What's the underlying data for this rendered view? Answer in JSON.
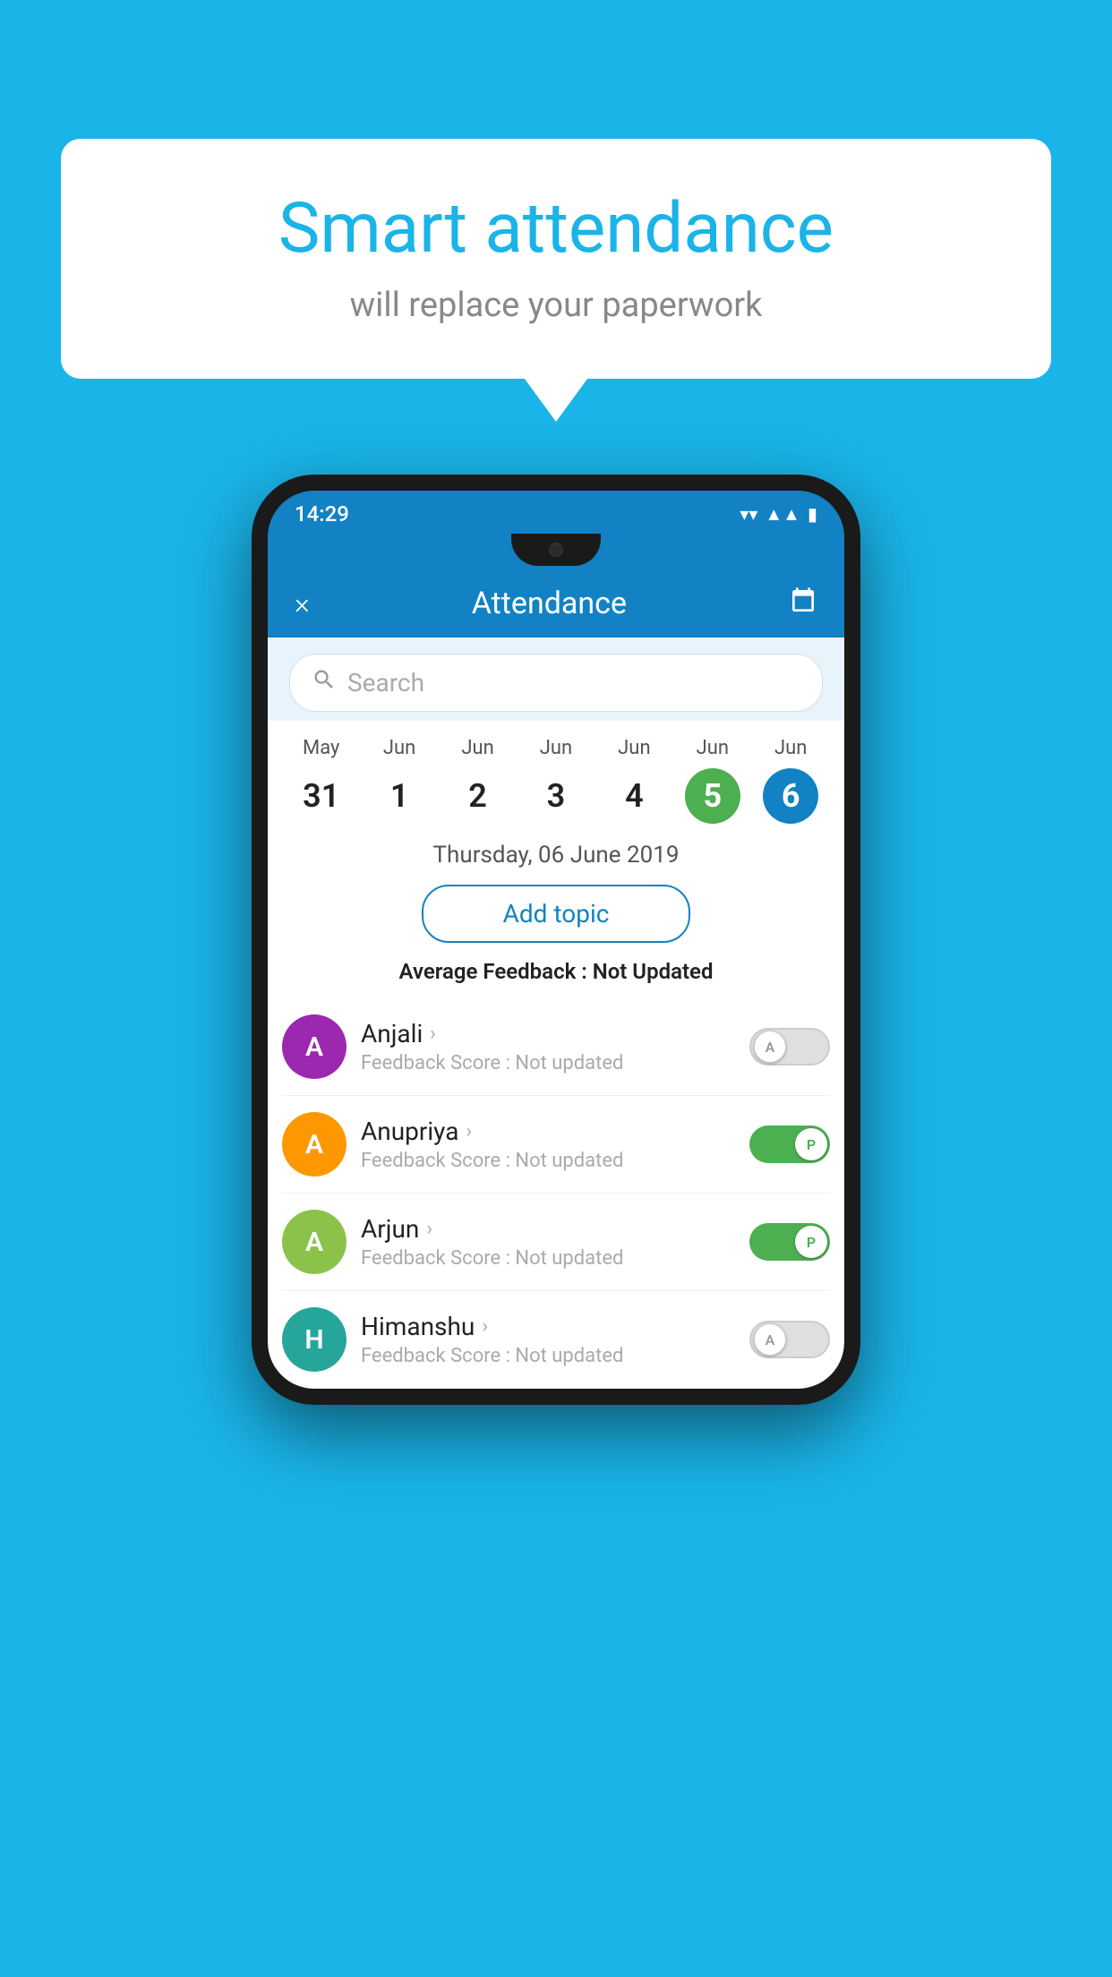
{
  "background_color": "#1ab4e8",
  "bubble": {
    "title": "Smart attendance",
    "subtitle": "will replace your paperwork"
  },
  "phone": {
    "status_bar": {
      "time": "14:29",
      "icons": [
        "wifi",
        "signal",
        "battery"
      ]
    },
    "header": {
      "close_label": "×",
      "title": "Attendance",
      "calendar_icon": "📅"
    },
    "search": {
      "placeholder": "Search"
    },
    "calendar": {
      "days": [
        {
          "month": "May",
          "date": "31",
          "active": false,
          "style": "none"
        },
        {
          "month": "Jun",
          "date": "1",
          "active": false,
          "style": "none"
        },
        {
          "month": "Jun",
          "date": "2",
          "active": false,
          "style": "none"
        },
        {
          "month": "Jun",
          "date": "3",
          "active": false,
          "style": "none"
        },
        {
          "month": "Jun",
          "date": "4",
          "active": false,
          "style": "none"
        },
        {
          "month": "Jun",
          "date": "5",
          "active": true,
          "style": "green"
        },
        {
          "month": "Jun",
          "date": "6",
          "active": true,
          "style": "blue"
        }
      ]
    },
    "selected_date": "Thursday, 06 June 2019",
    "add_topic_label": "Add topic",
    "avg_feedback_label": "Average Feedback :",
    "avg_feedback_value": "Not Updated",
    "students": [
      {
        "name": "Anjali",
        "avatar_letter": "A",
        "avatar_color": "purple",
        "feedback_label": "Feedback Score :",
        "feedback_value": "Not updated",
        "toggle": "off",
        "toggle_letter": "A"
      },
      {
        "name": "Anupriya",
        "avatar_letter": "A",
        "avatar_color": "orange",
        "feedback_label": "Feedback Score :",
        "feedback_value": "Not updated",
        "toggle": "on",
        "toggle_letter": "P"
      },
      {
        "name": "Arjun",
        "avatar_letter": "A",
        "avatar_color": "green-light",
        "feedback_label": "Feedback Score :",
        "feedback_value": "Not updated",
        "toggle": "on",
        "toggle_letter": "P"
      },
      {
        "name": "Himanshu",
        "avatar_letter": "H",
        "avatar_color": "teal",
        "feedback_label": "Feedback Score :",
        "feedback_value": "Not updated",
        "toggle": "off",
        "toggle_letter": "A"
      }
    ]
  }
}
